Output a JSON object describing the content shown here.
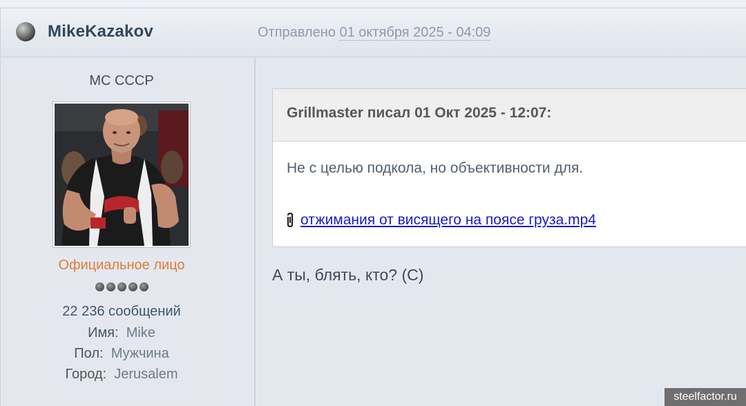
{
  "post": {
    "author": "MikeKazakov",
    "posted_label": "Отправлено",
    "posted_date": "01 октября 2025 - 04:09"
  },
  "profile": {
    "title": "МС СССР",
    "group": "Официальное лицо",
    "posts": "22 236 сообщений",
    "name_label": "Имя:",
    "name_value": "Mike",
    "gender_label": "Пол:",
    "gender_value": "Мужчина",
    "city_label": "Город:",
    "city_value": "Jerusalem",
    "rank_pips": 5
  },
  "quote": {
    "header": "Grillmaster писал 01 Окт 2025 - 12:07:",
    "text": "Не с целью подкола, но объективности для.",
    "attachment": "отжимания от висящего на поясе груза.mp4"
  },
  "reply": "А ты, блять, кто? (С)",
  "watermark": "steelfactor.ru",
  "colors": {
    "author": "#30475d",
    "group": "#e07b3c",
    "link": "#1a1acc"
  }
}
